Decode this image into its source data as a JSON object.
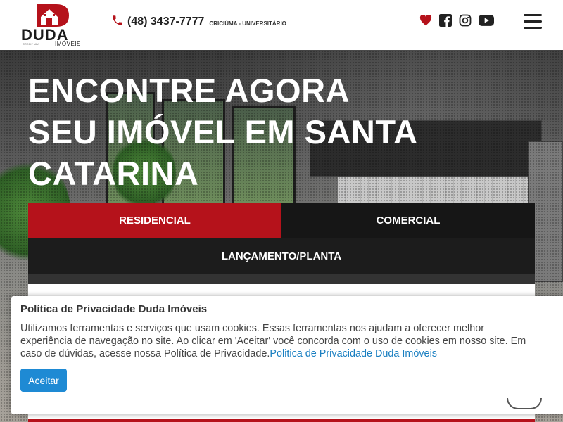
{
  "brand": {
    "logo_text": "DUDA",
    "logo_sub": "IMÓVEIS",
    "logo_tiny": "CRECI / NIU"
  },
  "contact": {
    "phone": "(48) 3437-7777",
    "location": "CRICIÚMA - UNIVERSITÁRIO"
  },
  "social_icons": [
    "heart-icon",
    "facebook-icon",
    "instagram-icon",
    "youtube-icon"
  ],
  "hero": {
    "title_lines": [
      "ENCONTRE AGORA",
      "SEU IMÓVEL EM SANTA",
      "CATARINA"
    ]
  },
  "tabs": [
    {
      "label": "RESIDENCIAL",
      "active": true
    },
    {
      "label": "COMERCIAL",
      "active": false
    },
    {
      "label": "LANÇAMENTO/PLANTA",
      "active": false
    }
  ],
  "cookie": {
    "title": "Política de Privacidade Duda Imóveis",
    "text_line1": "Utilizamos ferramentas e serviços que usam cookies. Essas ferramentas nos ajudam a oferecer melhor",
    "text_line2": "experiência de navegação no site. Ao clicar em 'Aceitar' você concorda com o uso de cookies em nosso site. Em",
    "text_line3": "caso de dúvidas, acesse nossa Política de Privacidade.",
    "link_text": "Politica de Privacidade Duda Imóveis",
    "accept_label": "Aceitar"
  },
  "colors": {
    "brand_red": "#b5121b",
    "dark_tab": "#161616",
    "accept_blue": "#1e8ad4",
    "link_blue": "#1a7fc1"
  }
}
